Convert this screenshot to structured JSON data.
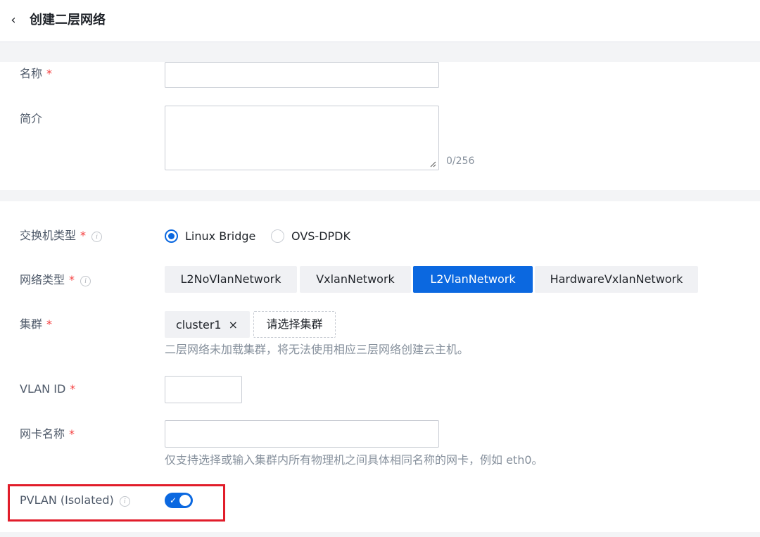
{
  "header": {
    "back_icon": "chevron-left-icon",
    "title": "创建二层网络"
  },
  "basic": {
    "name_label": "名称",
    "name_value": "",
    "desc_label": "简介",
    "desc_value": "",
    "desc_count": "0/256"
  },
  "config": {
    "required_mark": "*",
    "switch_type": {
      "label": "交换机类型",
      "options": [
        "Linux Bridge",
        "OVS-DPDK"
      ],
      "selected": "Linux Bridge"
    },
    "network_type": {
      "label": "网络类型",
      "options": [
        "L2NoVlanNetwork",
        "VxlanNetwork",
        "L2VlanNetwork",
        "HardwareVxlanNetwork"
      ],
      "selected": "L2VlanNetwork"
    },
    "cluster": {
      "label": "集群",
      "tag": "cluster1",
      "tag_close": "×",
      "select_button": "请选择集群",
      "hint": "二层网络未加载集群，将无法使用相应三层网络创建云主机。"
    },
    "vlan_id": {
      "label": "VLAN ID",
      "value": ""
    },
    "nic_name": {
      "label": "网卡名称",
      "value": "",
      "hint": "仅支持选择或输入集群内所有物理机之间具体相同名称的网卡，例如 eth0。"
    },
    "pvlan": {
      "label": "PVLAN (Isolated)",
      "enabled": true,
      "check": "✓"
    }
  },
  "colors": {
    "primary": "#0b68e0",
    "required": "#f53f3f",
    "highlight": "#e11d2a"
  }
}
